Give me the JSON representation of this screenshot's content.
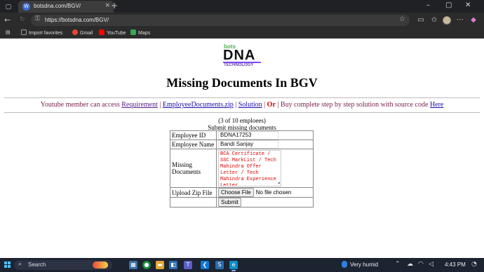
{
  "browser": {
    "tab_title": "botsdna.com/BGV/",
    "favicon_glyph": "W",
    "new_tab_glyph": "+",
    "url": "https://botsdna.com/BGV/",
    "bookmarks": [
      {
        "label": "Import favorites",
        "color": "#9aa0a6"
      },
      {
        "label": "Gmail",
        "color": "#ea4335"
      },
      {
        "label": "YouTube",
        "color": "#ff0000"
      },
      {
        "label": "Maps",
        "color": "#34a853"
      }
    ]
  },
  "page": {
    "logo": {
      "top": "bots",
      "main": "DNA",
      "bottom": "TECHNOLOGY"
    },
    "title": "Missing Documents In BGV",
    "link_line": {
      "intro": "Youtube member can access ",
      "requirement": "Requirement",
      "sep1": " | ",
      "zip": "EmployeeDocuments.zip",
      "sep2": " | ",
      "solution": "Solution",
      "sep3": " | ",
      "or": "Or",
      "sep4": " | ",
      "buy": "Buy complete step by step solution with source code ",
      "here": "Here"
    },
    "count": "(3 of 10 emploees)",
    "caption": "Submit missing documents",
    "form": {
      "employee_id_label": "Employee ID",
      "employee_id_value": "BDNA17253",
      "employee_name_label": "Employee Name",
      "employee_name_value": "Bandi Sanjay",
      "missing_label": "Missing Documents",
      "missing_value": "BCA Certificate /  SSC MarkList / Tech Mahindra Offer Letter / Tech Mahindra Experience Letter",
      "upload_label": "Upload Zip File",
      "choose_file": "Choose File",
      "no_file": "No file chosen",
      "submit": "Submit"
    }
  },
  "taskbar": {
    "search_text": "Search",
    "weather": "Very humid",
    "time": "4:43 PM"
  }
}
